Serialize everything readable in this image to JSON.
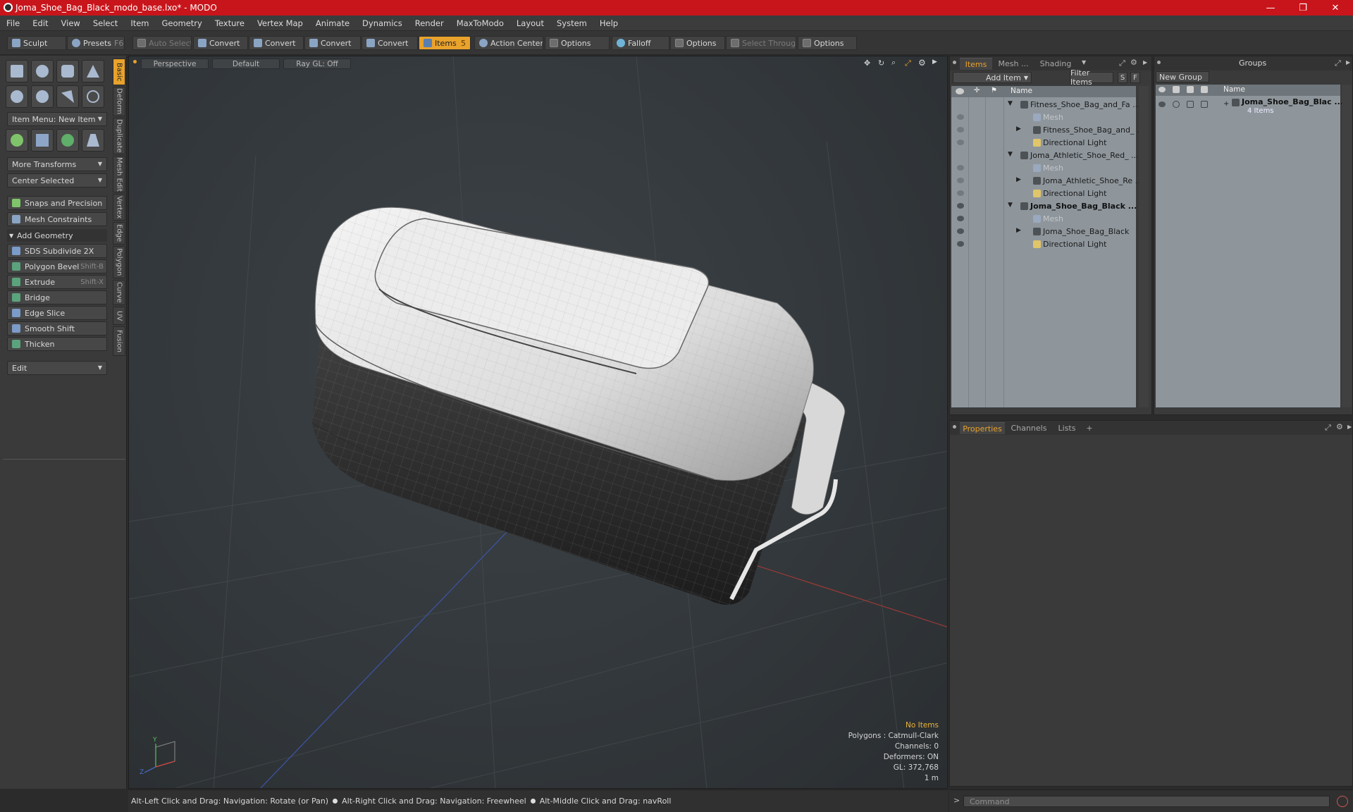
{
  "window": {
    "title": "Joma_Shoe_Bag_Black_modo_base.lxo* - MODO",
    "minimize": "—",
    "maximize": "❐",
    "close": "✕"
  },
  "menu": [
    "File",
    "Edit",
    "View",
    "Select",
    "Item",
    "Geometry",
    "Texture",
    "Vertex Map",
    "Animate",
    "Dynamics",
    "Render",
    "MaxToModo",
    "Layout",
    "System",
    "Help"
  ],
  "toolbar": {
    "sculpt": "Sculpt",
    "presets": "Presets",
    "presets_key": "F6",
    "auto_select": "Auto Select",
    "convert": "Convert",
    "items": "Items",
    "items_key": "5",
    "action_center": "Action Center",
    "options": "Options",
    "falloff": "Falloff",
    "select_through": "Select Through"
  },
  "left_panel": {
    "item_menu": "Item Menu: New Item",
    "more_transforms": "More Transforms",
    "center_selected": "Center Selected",
    "snaps": "Snaps and Precision",
    "mesh_constraints": "Mesh Constraints",
    "add_geometry": "Add Geometry",
    "tools": [
      {
        "label": "SDS Subdivide 2X",
        "key": ""
      },
      {
        "label": "Polygon Bevel",
        "key": "Shift-B"
      },
      {
        "label": "Extrude",
        "key": "Shift-X"
      },
      {
        "label": "Bridge",
        "key": ""
      },
      {
        "label": "Edge Slice",
        "key": ""
      },
      {
        "label": "Smooth Shift",
        "key": ""
      },
      {
        "label": "Thicken",
        "key": ""
      }
    ],
    "edit": "Edit"
  },
  "vtabs": [
    "Basic",
    "Deform",
    "Duplicate",
    "Mesh Edit",
    "Vertex",
    "Edge",
    "Polygon",
    "Curve",
    "UV",
    "Fusion"
  ],
  "viewport": {
    "perspective": "Perspective",
    "default": "Default",
    "raygl": "Ray GL: Off",
    "info": {
      "no_items": "No Items",
      "polygons": "Polygons : Catmull-Clark",
      "channels": "Channels: 0",
      "deformers": "Deformers: ON",
      "gl": "GL: 372,768",
      "scale": "1 m"
    }
  },
  "status": {
    "a": "Alt-Left Click and Drag: Navigation: Rotate (or Pan)",
    "b": "Alt-Right Click and Drag: Navigation: Freewheel",
    "c": "Alt-Middle Click and Drag: navRoll"
  },
  "items_panel": {
    "tabs": [
      "Items",
      "Mesh ...",
      "Shading"
    ],
    "add_item": "Add Item",
    "filter_items": "Filter Items",
    "s": "S",
    "f": "F",
    "col_name": "Name",
    "rows": [
      {
        "label": "Fitness_Shoe_Bag_and_Fa ...",
        "indent": 0,
        "arrow": "▼",
        "style": "normal"
      },
      {
        "label": "Mesh",
        "indent": 2,
        "arrow": "",
        "style": "grey"
      },
      {
        "label": "Fitness_Shoe_Bag_and_ ...",
        "indent": 2,
        "arrow": "▶",
        "style": "normal"
      },
      {
        "label": "Directional Light",
        "indent": 2,
        "arrow": "",
        "style": "normal"
      },
      {
        "label": "Joma_Athletic_Shoe_Red_ ...",
        "indent": 0,
        "arrow": "▼",
        "style": "normal"
      },
      {
        "label": "Mesh",
        "indent": 2,
        "arrow": "",
        "style": "grey"
      },
      {
        "label": "Joma_Athletic_Shoe_Re ...",
        "indent": 2,
        "arrow": "▶",
        "style": "normal"
      },
      {
        "label": "Directional Light",
        "indent": 2,
        "arrow": "",
        "style": "normal"
      },
      {
        "label": "Joma_Shoe_Bag_Black ...",
        "indent": 0,
        "arrow": "▼",
        "style": "bold"
      },
      {
        "label": "Mesh",
        "indent": 2,
        "arrow": "",
        "style": "grey"
      },
      {
        "label": "Joma_Shoe_Bag_Black",
        "indent": 2,
        "arrow": "▶",
        "style": "normal"
      },
      {
        "label": "Directional Light",
        "indent": 2,
        "arrow": "",
        "style": "normal"
      }
    ]
  },
  "groups_panel": {
    "title": "Groups",
    "new_group": "New Group",
    "col_name": "Name",
    "group_name": "Joma_Shoe_Bag_Blac ...",
    "group_count": "4 Items"
  },
  "props_panel": {
    "tabs": [
      "Properties",
      "Channels",
      "Lists"
    ],
    "add": "+"
  },
  "command": {
    "prompt": ">",
    "placeholder": "Command"
  }
}
